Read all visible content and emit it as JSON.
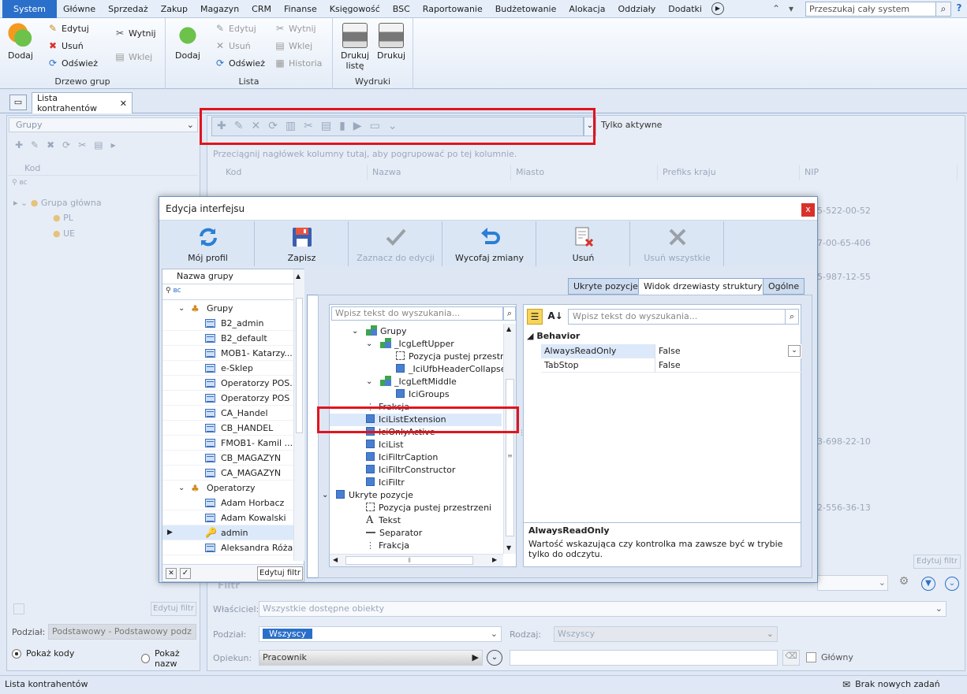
{
  "menu": {
    "items": [
      "System",
      "Główne",
      "Sprzedaż",
      "Zakup",
      "Magazyn",
      "CRM",
      "Finanse",
      "Księgowość",
      "BSC",
      "Raportowanie",
      "Budżetowanie",
      "Alokacja",
      "Oddziały",
      "Dodatki"
    ],
    "search_placeholder": "Przeszukaj cały system"
  },
  "ribbon": {
    "tree_group": {
      "label": "Drzewo grup",
      "add": "Dodaj",
      "edit": "Edytuj",
      "delete": "Usuń",
      "refresh": "Odśwież",
      "cut": "Wytnij",
      "paste": "Wklej"
    },
    "list_group": {
      "label": "Lista",
      "add": "Dodaj",
      "edit": "Edytuj",
      "delete": "Usuń",
      "refresh": "Odśwież",
      "cut": "Wytnij",
      "paste": "Wklej",
      "history": "Historia"
    },
    "print_group": {
      "label": "Wydruki",
      "print_list": "Drukuj listę",
      "print": "Drukuj"
    }
  },
  "tab": {
    "title": "Lista kontrahentów",
    "close": "✕"
  },
  "left_panel": {
    "groups_label": "Grupy",
    "column": "Kod",
    "filter_text": "ʙᴄ",
    "tree": [
      {
        "label": "Grupa główna"
      },
      {
        "label": "PL"
      },
      {
        "label": "UE"
      }
    ],
    "edit_filter": "Edytuj filtr",
    "division_label": "Podział:",
    "division_value": "Podstawowy - Podstawowy podz",
    "show_codes": "Pokaż kody",
    "show_names": "Pokaż nazw"
  },
  "main": {
    "only_active": "Tylko aktywne",
    "group_hint": "Przeciągnij nagłówek kolumny tutaj, aby pogrupować po tej kolumnie.",
    "columns": [
      "Kod",
      "Nazwa",
      "Miasto",
      "Prefiks kraju",
      "NIP"
    ],
    "nips": [
      "5-522-00-52",
      "7-00-65-406",
      "5-987-12-55",
      "3-698-22-10",
      "2-556-36-13"
    ],
    "edit_filter": "Edytuj filtr",
    "filter_label": "Filtr",
    "owner_label": "Właściciel:",
    "owner_value": "Wszystkie dostępne obiekty",
    "division_label": "Podział:",
    "division_value": "Wszyscy",
    "kind_label": "Rodzaj:",
    "kind_value": "Wszyscy",
    "keeper_label": "Opiekun:",
    "keeper_value": "Pracownik",
    "main_label": "Główny"
  },
  "status": {
    "left": "Lista kontrahentów",
    "right": "Brak nowych zadań"
  },
  "dialog": {
    "title": "Edycja interfejsu",
    "close": "x",
    "buttons": [
      "Mój profil",
      "Zapisz",
      "Zaznacz do edycji",
      "Wycofaj zmiany",
      "Usuń",
      "Usuń wszystkie"
    ],
    "group_column": "Nazwa grupy",
    "filter_text": "ʙᴄ",
    "groups": [
      {
        "label": "Grupy",
        "type": "header"
      },
      {
        "label": "B2_admin"
      },
      {
        "label": "B2_default"
      },
      {
        "label": "MOB1- Katarzy..."
      },
      {
        "label": "e-Sklep"
      },
      {
        "label": "Operatorzy POS..."
      },
      {
        "label": "Operatorzy POS"
      },
      {
        "label": "CA_Handel"
      },
      {
        "label": "CB_HANDEL"
      },
      {
        "label": "FMOB1- Kamil ..."
      },
      {
        "label": "CB_MAGAZYN"
      },
      {
        "label": "CA_MAGAZYN"
      },
      {
        "label": "Operatorzy",
        "type": "header"
      },
      {
        "label": "Adam Horbacz"
      },
      {
        "label": "Adam Kowalski"
      },
      {
        "label": "admin",
        "type": "key"
      },
      {
        "label": "Aleksandra Róża"
      }
    ],
    "edit_filter": "Edytuj filtr",
    "tabs": [
      "Ukryte pozycje",
      "Widok drzewiasty struktury",
      "Ogólne"
    ],
    "tree_search_placeholder": "Wpisz tekst do wyszukania...",
    "prop_search_placeholder": "Wpisz tekst do wyszukania...",
    "structure": [
      {
        "label": "Grupy",
        "lvl": 0,
        "icon": "grp",
        "exp": true
      },
      {
        "label": "_IcgLeftUpper",
        "lvl": 1,
        "icon": "grp",
        "exp": true
      },
      {
        "label": "Pozycja pustej przestrz",
        "lvl": 2,
        "icon": "space"
      },
      {
        "label": "_IciUfbHeaderCollapse",
        "lvl": 2,
        "icon": "sq"
      },
      {
        "label": "_IcgLeftMiddle",
        "lvl": 1,
        "icon": "grp",
        "exp": true
      },
      {
        "label": "IciGroups",
        "lvl": 2,
        "icon": "sq"
      },
      {
        "label": "Frakcja",
        "lvl": -1,
        "icon": "frak"
      },
      {
        "label": "IciListExtension",
        "lvl": -1,
        "icon": "sq",
        "selected": true
      },
      {
        "label": "IciOnlyActive",
        "lvl": -1,
        "icon": "sq"
      },
      {
        "label": "IciList",
        "lvl": -1,
        "icon": "sq"
      },
      {
        "label": "IciFiltrCaption",
        "lvl": -1,
        "icon": "sq"
      },
      {
        "label": "IciFiltrConstructor",
        "lvl": -1,
        "icon": "sq"
      },
      {
        "label": "IciFiltr",
        "lvl": -1,
        "icon": "sq"
      },
      {
        "label": "Ukryte pozycje",
        "lvl": -2,
        "icon": "sq",
        "exp": true
      },
      {
        "label": "Pozycja pustej przestrzeni",
        "lvl": -1,
        "icon": "space"
      },
      {
        "label": "Tekst",
        "lvl": -1,
        "icon": "text"
      },
      {
        "label": "Separator",
        "lvl": -1,
        "icon": "sep"
      },
      {
        "label": "Frakcja",
        "lvl": -1,
        "icon": "frak"
      }
    ],
    "properties": {
      "category": "Behavior",
      "rows": [
        {
          "name": "AlwaysReadOnly",
          "value": "False"
        },
        {
          "name": "TabStop",
          "value": "False"
        }
      ],
      "desc_title": "AlwaysReadOnly",
      "desc_text": "Wartość wskazująca czy kontrolka ma zawsze być w trybie tylko do odczytu."
    }
  },
  "colors": {
    "accent": "#2a6fc9",
    "highlight": "#e0141e",
    "selection": "#dce9fb"
  }
}
